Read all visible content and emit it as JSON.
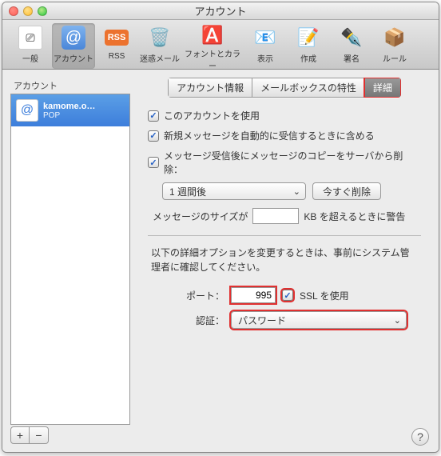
{
  "window": {
    "title": "アカウント"
  },
  "toolbar": {
    "items": [
      {
        "label": "一般"
      },
      {
        "label": "アカウント"
      },
      {
        "label": "RSS"
      },
      {
        "label": "迷惑メール"
      },
      {
        "label": "フォントとカラー"
      },
      {
        "label": "表示"
      },
      {
        "label": "作成"
      },
      {
        "label": "署名"
      },
      {
        "label": "ルール"
      }
    ]
  },
  "sidebar": {
    "header": "アカウント",
    "items": [
      {
        "name": "kamome.o…",
        "type": "POP"
      }
    ]
  },
  "tabs": {
    "items": [
      "アカウント情報",
      "メールボックスの特性",
      "詳細"
    ],
    "active": 2
  },
  "panel": {
    "use_account_label": "このアカウントを使用",
    "auto_receive_label": "新規メッセージを自動的に受信するときに含める",
    "delete_copy_label": "メッセージ受信後にメッセージのコピーをサーバから削除：",
    "retention_value": "1 週間後",
    "delete_now_label": "今すぐ削除",
    "size_prefix": "メッセージのサイズが",
    "size_value": "",
    "size_suffix": "KB を超えるときに警告",
    "note": "以下の詳細オプションを変更するときは、事前にシステム管理者に確認してください。",
    "port_label": "ポート：",
    "port_value": "995",
    "ssl_label": "SSL を使用",
    "auth_label": "認証：",
    "auth_value": "パスワード"
  }
}
